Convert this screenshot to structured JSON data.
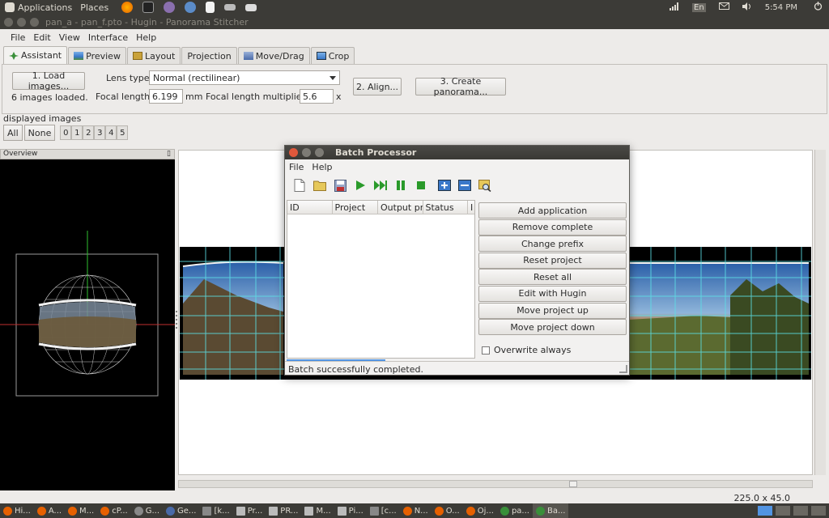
{
  "top_panel": {
    "applications": "Applications",
    "places": "Places",
    "clock": "5:54 PM",
    "keyboard_indicator": "En"
  },
  "window": {
    "title": "pan_a - pan_f.pto - Hugin - Panorama Stitcher"
  },
  "menubar": [
    "File",
    "Edit",
    "View",
    "Interface",
    "Help"
  ],
  "tabs": [
    {
      "label": "Assistant",
      "icon": "assistant-icon",
      "color": "#3a8f3a"
    },
    {
      "label": "Preview",
      "icon": "preview-icon",
      "color": "#3a78c9"
    },
    {
      "label": "Layout",
      "icon": "layout-icon",
      "color": "#c9a23a"
    },
    {
      "label": "Projection",
      "icon": "",
      "color": ""
    },
    {
      "label": "Move/Drag",
      "icon": "move-drag-icon",
      "color": "#4a6aa8"
    },
    {
      "label": "Crop",
      "icon": "crop-icon",
      "color": "#3a78c9"
    }
  ],
  "assistant": {
    "load_button": "1. Load images...",
    "images_loaded": "6 images loaded.",
    "lens_type_label": "Lens type:",
    "lens_type_value": "Normal (rectilinear)",
    "focal_length_label": "Focal length:",
    "focal_length_value": "6.199",
    "focal_unit": "mm",
    "multiplier_label": "Focal length multiplier:",
    "multiplier_value": "5.6",
    "multiplier_unit": "x",
    "align_button": "2. Align...",
    "create_button": "3. Create panorama..."
  },
  "displayed_images": {
    "label": "displayed images",
    "all": "All",
    "none": "None",
    "toggles": [
      "0",
      "1",
      "2",
      "3",
      "4",
      "5"
    ]
  },
  "overview": {
    "title": "Overview"
  },
  "status_bar": {
    "canvas_size": "225.0 x 45.0"
  },
  "batch_processor": {
    "title": "Batch Processor",
    "menu": [
      "File",
      "Help"
    ],
    "toolbar_icons": [
      "new-file-icon",
      "open-folder-icon",
      "save-icon",
      "play-icon",
      "skip-icon",
      "pause-icon",
      "stop-icon",
      "add-project-icon",
      "remove-project-icon",
      "search-icon"
    ],
    "columns": [
      "ID",
      "Project",
      "Output pre",
      "Status",
      "I"
    ],
    "buttons": [
      "Add application",
      "Remove complete",
      "Change prefix",
      "Reset project",
      "Reset all",
      "Edit with Hugin",
      "Move project up",
      "Move project down"
    ],
    "overwrite_label": "Overwrite always",
    "status_text": "Batch successfully completed."
  },
  "taskbar": [
    {
      "label": "Hi...",
      "color": "#e66000"
    },
    {
      "label": "A...",
      "color": "#e66000"
    },
    {
      "label": "M...",
      "color": "#e66000"
    },
    {
      "label": "cP...",
      "color": "#e66000"
    },
    {
      "label": "G...",
      "color": "#888"
    },
    {
      "label": "Ge...",
      "color": "#4a6aa8"
    },
    {
      "label": "[k...",
      "color": "#888"
    },
    {
      "label": "Pr...",
      "color": "#888"
    },
    {
      "label": "PR...",
      "color": "#888"
    },
    {
      "label": "M...",
      "color": "#888"
    },
    {
      "label": "Pi...",
      "color": "#888"
    },
    {
      "label": "[c...",
      "color": "#888"
    },
    {
      "label": "N...",
      "color": "#e66000"
    },
    {
      "label": "O...",
      "color": "#e66000"
    },
    {
      "label": "Oj...",
      "color": "#e66000"
    },
    {
      "label": "pa...",
      "color": "#3a8f3a"
    },
    {
      "label": "Ba...",
      "color": "#3a8f3a"
    }
  ]
}
